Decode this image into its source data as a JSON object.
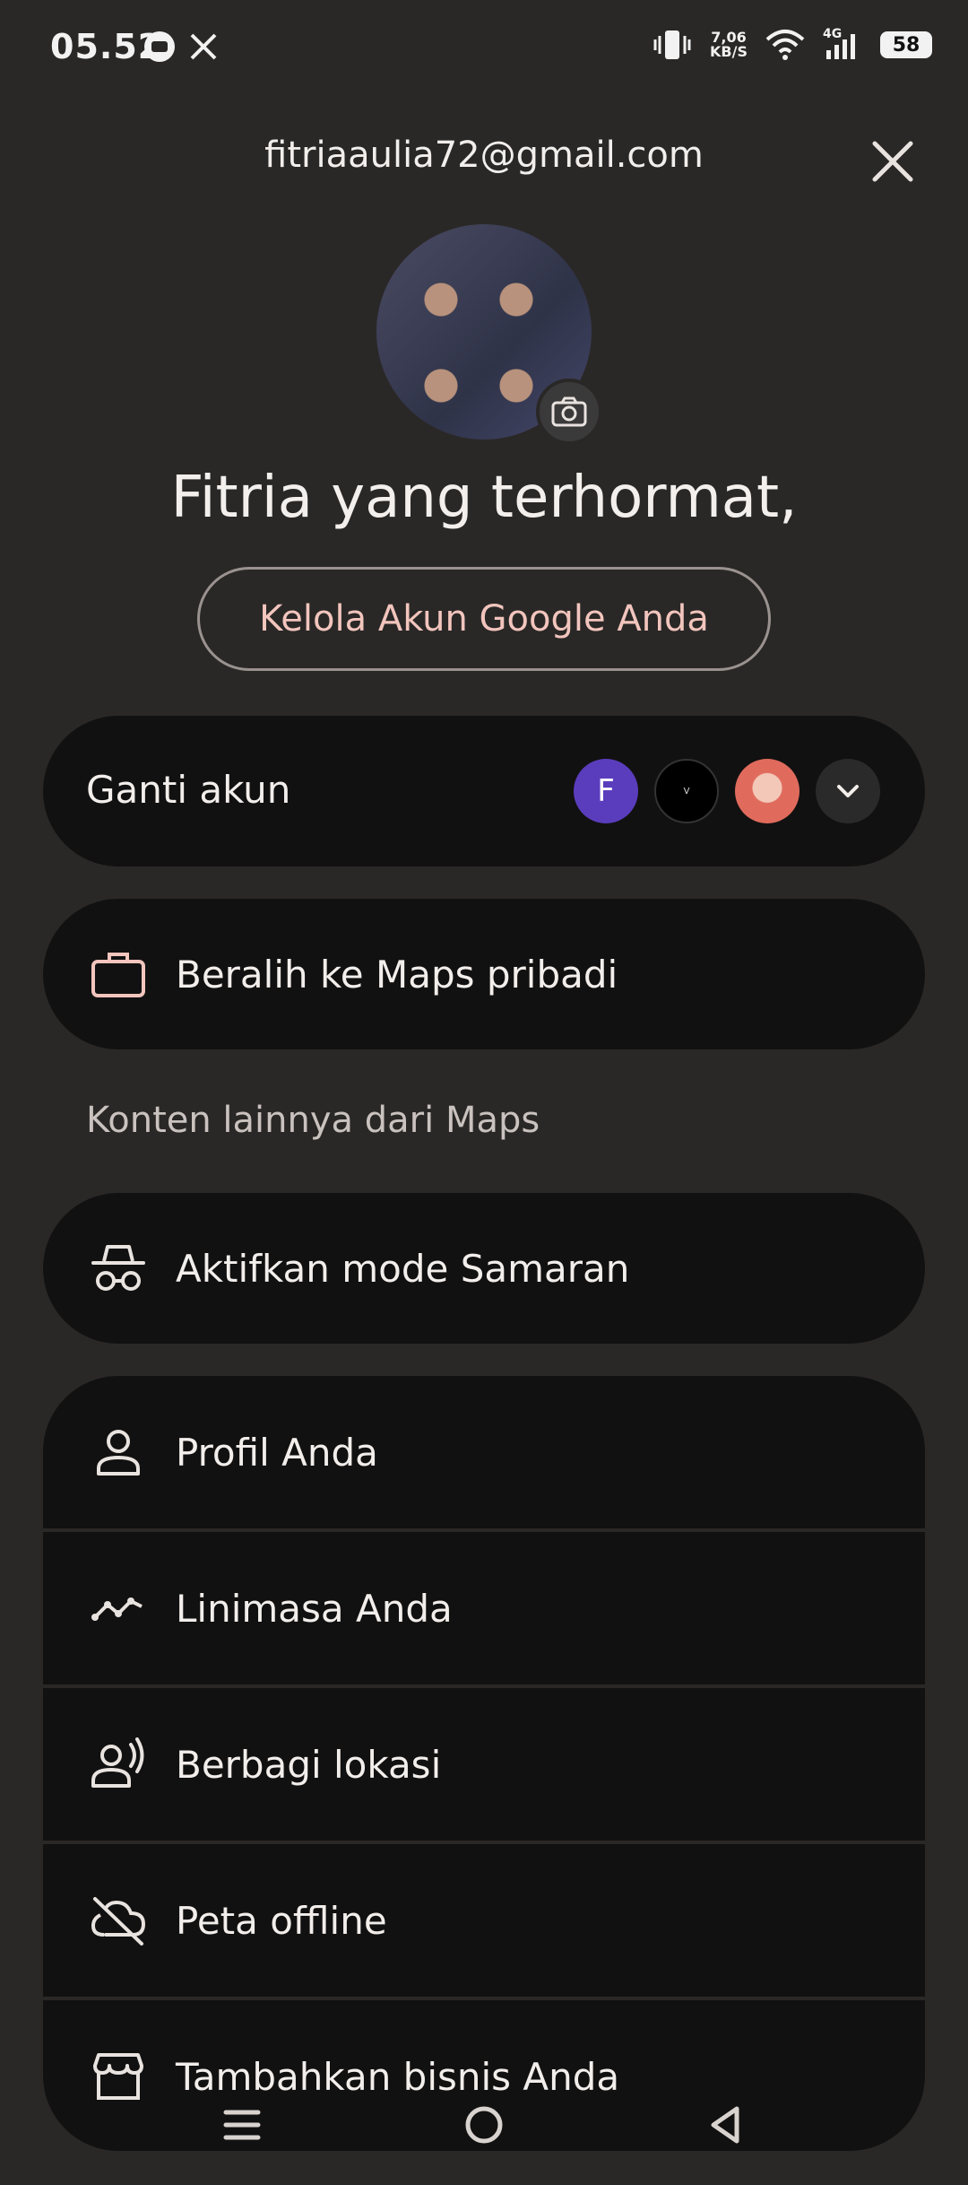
{
  "status_bar": {
    "time": "05.52",
    "net_speed_value": "7,06",
    "net_speed_unit": "KB/S",
    "network": "4G",
    "battery": "58"
  },
  "header": {
    "email": "fitriaaulia72@gmail.com",
    "greeting": "Fitria yang terhormat,",
    "manage_button": "Kelola Akun Google Anda"
  },
  "switch_account": {
    "label": "Ganti akun",
    "accounts": [
      {
        "initial": "F",
        "color": "#5a3dbd"
      },
      {
        "initial": "V",
        "color": "#000000"
      },
      {
        "initial": "",
        "color": "#e06b5d"
      }
    ]
  },
  "maps_mode": {
    "label": "Beralih ke Maps pribadi",
    "icon": "briefcase-icon"
  },
  "section_title": "Konten lainnya dari Maps",
  "incognito": {
    "label": "Aktifkan mode Samaran",
    "icon": "incognito-icon"
  },
  "menu": [
    {
      "label": "Profil Anda",
      "icon": "person-icon"
    },
    {
      "label": "Linimasa Anda",
      "icon": "timeline-icon"
    },
    {
      "label": "Berbagi lokasi",
      "icon": "location-sharing-icon"
    },
    {
      "label": "Peta offline",
      "icon": "cloud-off-icon"
    },
    {
      "label": "Tambahkan bisnis Anda",
      "icon": "storefront-icon"
    }
  ],
  "colors": {
    "background": "#2a2827",
    "card": "#121111",
    "accent_text": "#f2c5bd",
    "icon": "#f2c5bd"
  }
}
